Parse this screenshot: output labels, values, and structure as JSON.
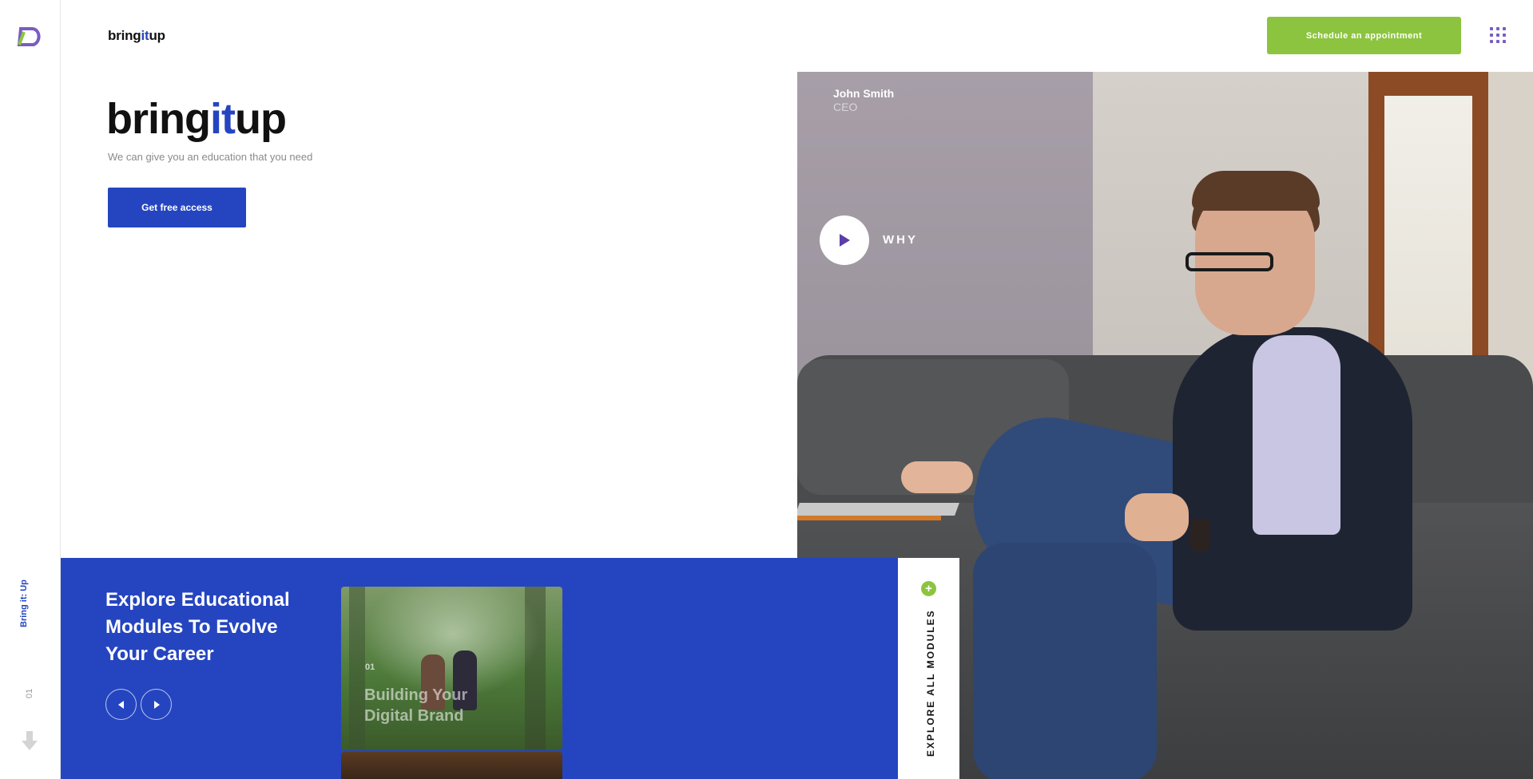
{
  "header": {
    "brand_prefix": "bring",
    "brand_highlight": "it",
    "brand_suffix": "up",
    "schedule_label": "Schedule an appointment",
    "menu_icon": "grid-menu-icon"
  },
  "rail": {
    "logo": "brand-logo-icon",
    "brand_label": "Bring it: Up",
    "slide_number": "01",
    "scroll_icon": "arrow-down-icon"
  },
  "hero": {
    "title_prefix": "bring",
    "title_highlight": "it",
    "title_suffix": "up",
    "subtitle": "We can give you an education that you need",
    "cta_label": "Get free access"
  },
  "person": {
    "name": "John Smith",
    "role": "CEO",
    "play_label": "WHY"
  },
  "modules": {
    "title": "Explore Educational Modules To Evolve Your Career",
    "card_number": "01",
    "card_title": "Building Your Digital Brand",
    "explore_label": "EXPLORE ALL MODULES"
  },
  "colors": {
    "accent_blue": "#2545c0",
    "accent_green": "#8cc43f",
    "accent_purple": "#7a5cc2"
  }
}
